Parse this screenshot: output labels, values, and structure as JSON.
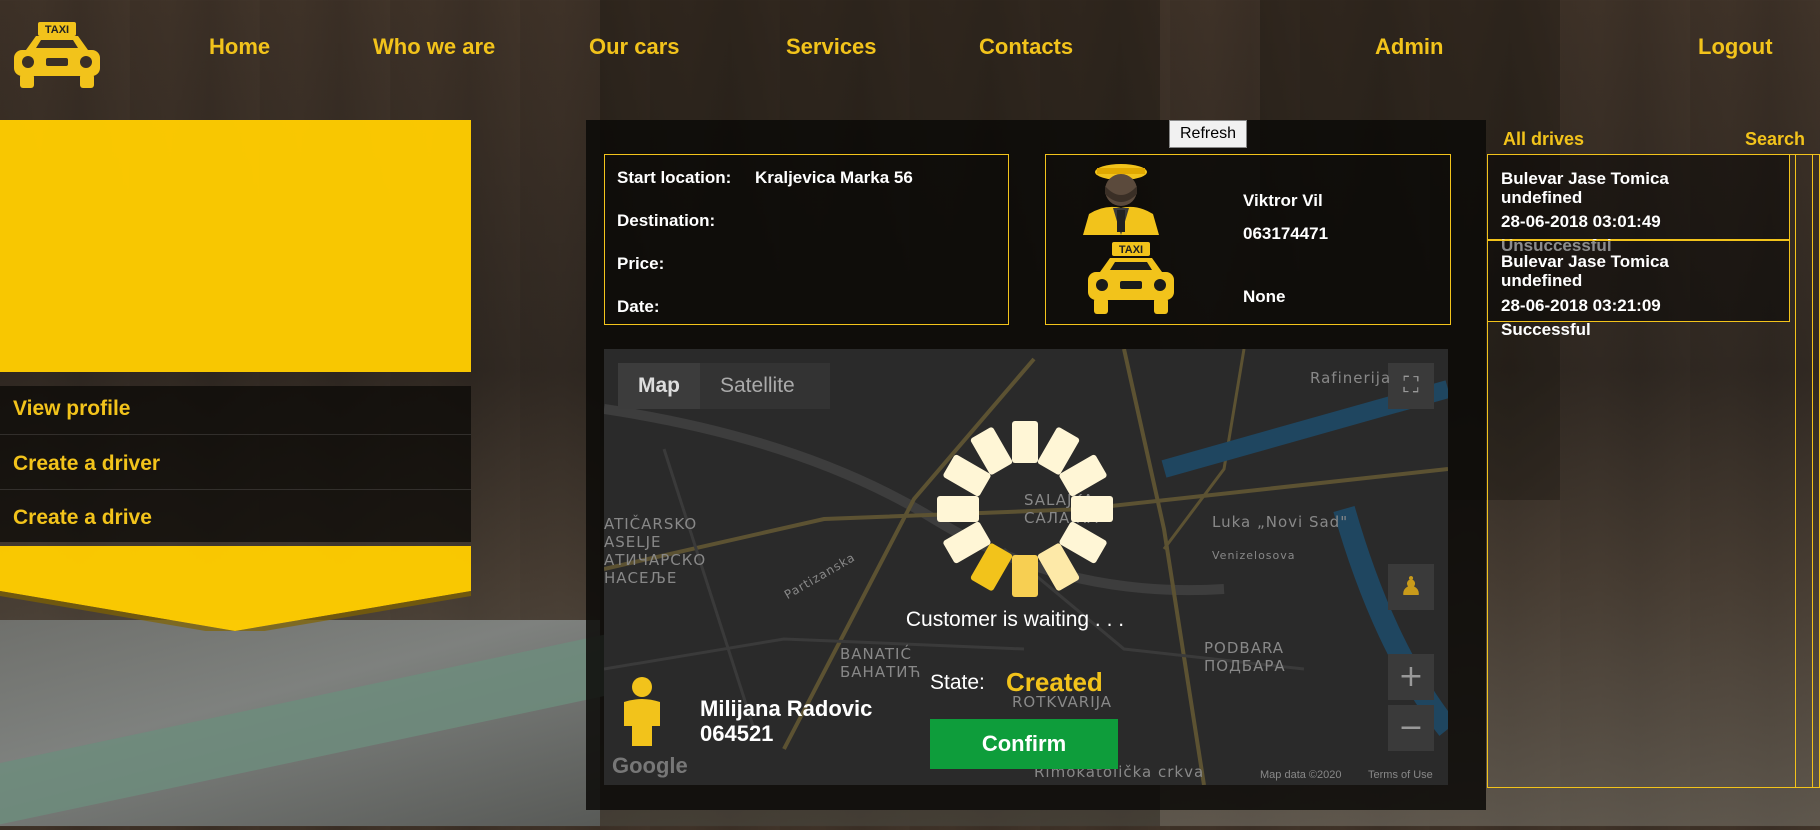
{
  "nav": {
    "home": "Home",
    "who_we_are": "Who we are",
    "our_cars": "Our cars",
    "services": "Services",
    "contacts": "Contacts",
    "admin": "Admin",
    "logout": "Logout",
    "logo_text": "TAXI"
  },
  "sidebar": {
    "items": [
      {
        "label": "View profile"
      },
      {
        "label": "Create a driver"
      },
      {
        "label": "Create a drive"
      }
    ]
  },
  "drive": {
    "refresh_label": "Refresh",
    "start_location_label": "Start location:",
    "start_location_value": "Kraljevica Marka 56",
    "destination_label": "Destination:",
    "destination_value": "",
    "price_label": "Price:",
    "price_value": "",
    "date_label": "Date:",
    "date_value": ""
  },
  "driver": {
    "name": "Viktror Vil",
    "phone": "063174471",
    "car": "None",
    "car_badge": "TAXI"
  },
  "map": {
    "tab_map": "Map",
    "tab_satellite": "Satellite",
    "zoom_in": "+",
    "zoom_out": "−",
    "google": "Google",
    "attribution": "Map data ©2020",
    "terms": "Terms of Use",
    "labels": [
      {
        "text": "Rafinerija"
      },
      {
        "text": "Luka „Novi Sad\""
      },
      {
        "text": "PODBARA"
      },
      {
        "text": "ПОДБАРА"
      },
      {
        "text": "BANATIĆ"
      },
      {
        "text": "БАНАТИЋ"
      },
      {
        "text": "SALAJKA"
      },
      {
        "text": "САЛАЈКА"
      },
      {
        "text": "ATIČARSKO"
      },
      {
        "text": "ASELJE"
      },
      {
        "text": "АТИЧАРСКО"
      },
      {
        "text": "НАСЕЉЕ"
      },
      {
        "text": "Partizanska"
      },
      {
        "text": "Venizelosova"
      },
      {
        "text": "ROTKVARIJA"
      },
      {
        "text": "Rimokatolička crkva"
      }
    ]
  },
  "status": {
    "waiting_text": "Customer is waiting . . .",
    "state_label": "State:",
    "state_value": "Created",
    "confirm_label": "Confirm"
  },
  "customer": {
    "name": "Milijana Radovic",
    "phone": "064521"
  },
  "drives_panel": {
    "all_drives_label": "All drives",
    "search_label": "Search",
    "drives": [
      {
        "location": "Bulevar Jase Tomica",
        "destination": "undefined",
        "date": "28-06-2018 03:01:49",
        "status": "Unsuccessful"
      },
      {
        "location": "Bulevar Jase Tomica",
        "destination": "undefined",
        "date": "28-06-2018 03:21:09",
        "status": "Successful"
      }
    ]
  },
  "colors": {
    "accent_yellow": "#f2c31b",
    "panel_yellow": "#ffcc00",
    "confirm_green": "#0e9d3b"
  }
}
